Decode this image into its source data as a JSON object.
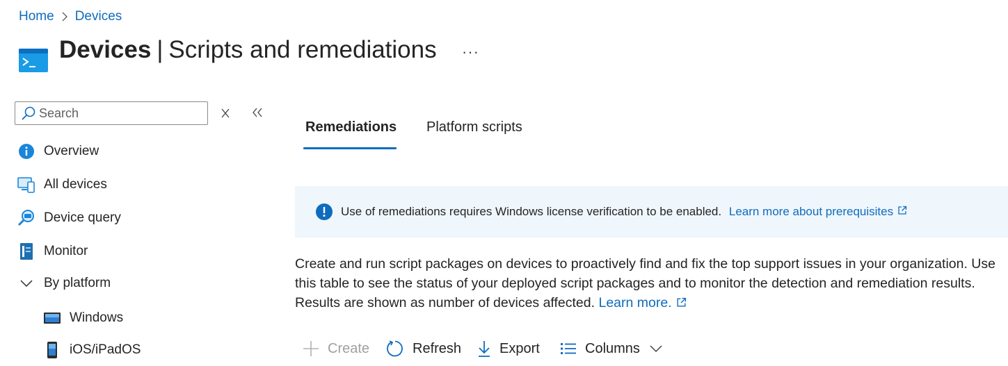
{
  "breadcrumb": {
    "home": "Home",
    "devices": "Devices"
  },
  "header": {
    "title_main": "Devices",
    "title_separator": "|",
    "title_sub": "Scripts and remediations",
    "more_label": "···"
  },
  "search": {
    "placeholder": "Search",
    "value": ""
  },
  "nav": {
    "items": [
      {
        "label": "Overview",
        "icon": "info-icon"
      },
      {
        "label": "All devices",
        "icon": "devices-icon"
      },
      {
        "label": "Device query",
        "icon": "device-query-icon"
      },
      {
        "label": "Monitor",
        "icon": "monitor-icon"
      },
      {
        "label": "By platform",
        "icon": "chevron-down-icon"
      }
    ],
    "sub_items": [
      {
        "label": "Windows",
        "icon": "windows-device-icon"
      },
      {
        "label": "iOS/iPadOS",
        "icon": "ios-device-icon"
      }
    ]
  },
  "tabs": [
    {
      "label": "Remediations",
      "active": true
    },
    {
      "label": "Platform scripts",
      "active": false
    }
  ],
  "banner": {
    "text": "Use of remediations requires Windows license verification to be enabled.",
    "link": "Learn more about prerequisites"
  },
  "description": {
    "text": "Create and run script packages on devices to proactively find and fix the top support issues in your organization. Use this table to see the status of your deployed script packages and to monitor the detection and remediation results. Results are shown as number of devices affected.",
    "link": "Learn more."
  },
  "toolbar": {
    "create": "Create",
    "refresh": "Refresh",
    "export": "Export",
    "columns": "Columns"
  },
  "colors": {
    "accent": "#0f6cbd",
    "banner_bg": "#eff6fc",
    "text": "#242424"
  }
}
